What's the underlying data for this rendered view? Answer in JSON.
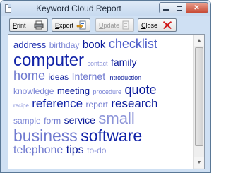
{
  "window": {
    "title": "Keyword Cloud Report",
    "close_glyph": "✕"
  },
  "toolbar": {
    "print": {
      "label_prefix": "P",
      "label_rest": "rint",
      "icon": "printer-icon"
    },
    "export": {
      "label_prefix": "E",
      "label_rest": "xport",
      "icon": "export-icon"
    },
    "update": {
      "label_prefix": "U",
      "label_rest": "pdate",
      "icon": "update-icon",
      "disabled": true
    },
    "close": {
      "label_prefix": "C",
      "label_rest": "lose",
      "icon": "red-x-icon"
    }
  },
  "cloud": {
    "words": [
      {
        "text": "address",
        "size": 13,
        "color": "#1f2fb0"
      },
      {
        "text": "birthday",
        "size": 12,
        "color": "#7b85d6"
      },
      {
        "text": "book",
        "size": 15,
        "color": "#0a1a9a"
      },
      {
        "text": "checklist",
        "size": 18,
        "color": "#4a5ac8"
      },
      {
        "text": "computer",
        "size": 24,
        "color": "#1223a8"
      },
      {
        "text": "contact",
        "size": 9,
        "color": "#8b93d8"
      },
      {
        "text": "family",
        "size": 14,
        "color": "#0a1a9a"
      },
      {
        "text": "home",
        "size": 18,
        "color": "#6f79cf"
      },
      {
        "text": "ideas",
        "size": 12,
        "color": "#0a1a9a"
      },
      {
        "text": "Internet",
        "size": 14,
        "color": "#6f79cf"
      },
      {
        "text": "introduction",
        "size": 9,
        "color": "#0a1a9a"
      },
      {
        "text": "knowledge",
        "size": 12,
        "color": "#7b85d6"
      },
      {
        "text": "meeting",
        "size": 13,
        "color": "#0a1a9a"
      },
      {
        "text": "procedure",
        "size": 9,
        "color": "#7b85d6"
      },
      {
        "text": "quote",
        "size": 18,
        "color": "#0a1a9a"
      },
      {
        "text": "recipe",
        "size": 8,
        "color": "#7b85d6"
      },
      {
        "text": "reference",
        "size": 17,
        "color": "#1223a8"
      },
      {
        "text": "report",
        "size": 12,
        "color": "#6f79cf"
      },
      {
        "text": "research",
        "size": 17,
        "color": "#0a1a9a"
      },
      {
        "text": "sample",
        "size": 12,
        "color": "#7b85d6"
      },
      {
        "text": "form",
        "size": 12,
        "color": "#6f79cf"
      },
      {
        "text": "service",
        "size": 14,
        "color": "#0a1a9a"
      },
      {
        "text": "small",
        "size": 22,
        "color": "#8b93d8"
      },
      {
        "text": "business",
        "size": 23,
        "color": "#6f79cf"
      },
      {
        "text": "software",
        "size": 23,
        "color": "#1223a8"
      },
      {
        "text": "telephone",
        "size": 16,
        "color": "#6f79cf"
      },
      {
        "text": "tips",
        "size": 16,
        "color": "#0a1a9a"
      },
      {
        "text": "to-do",
        "size": 12,
        "color": "#8b93d8"
      }
    ],
    "lines": [
      [
        0,
        1,
        2,
        3
      ],
      [
        4,
        5,
        6
      ],
      [
        7,
        8,
        9,
        10
      ],
      [
        11,
        12,
        13,
        14
      ],
      [
        15,
        16,
        17,
        18
      ],
      [
        19,
        20,
        21,
        22
      ],
      [
        23,
        24
      ],
      [
        25,
        26,
        27
      ]
    ]
  },
  "scrollbar": {
    "up_glyph": "▲",
    "down_glyph": "▼"
  },
  "colors": {
    "title_bar": "#c6d9ef",
    "close_red": "#c74a35",
    "x_icon_red": "#d01818"
  }
}
